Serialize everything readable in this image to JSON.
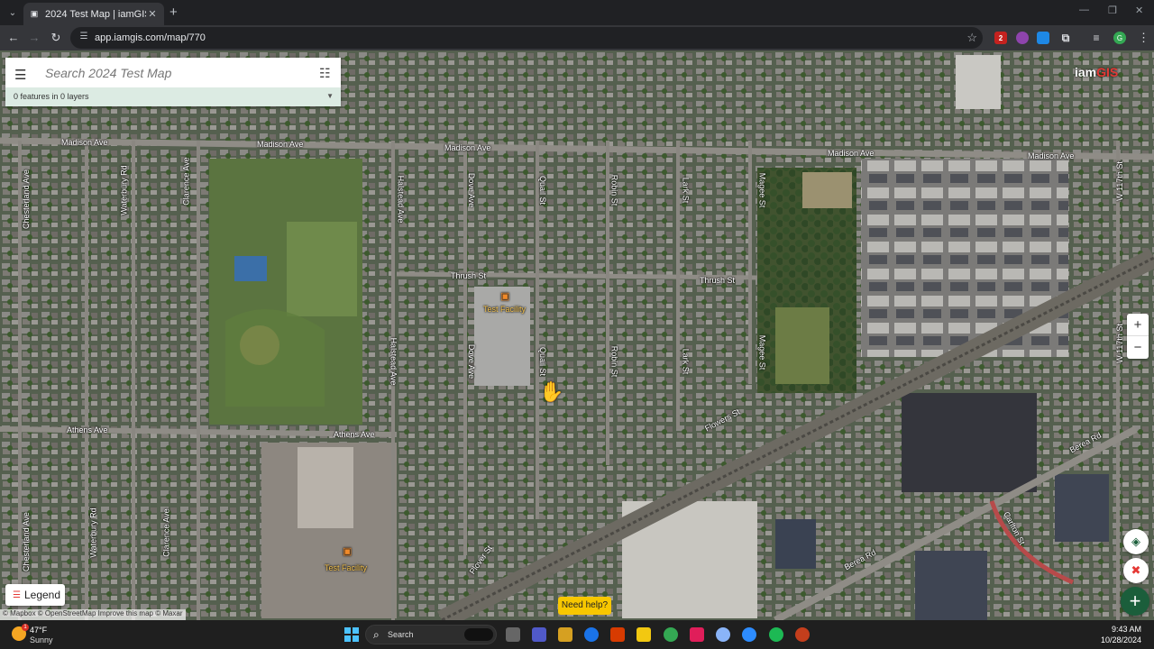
{
  "browser": {
    "tab_title": "2024 Test Map | iamGIS",
    "url": "app.iamgis.com/map/770",
    "ext_badges": [
      "2"
    ]
  },
  "map": {
    "search_placeholder": "Search 2024 Test Map",
    "features_summary": "0 features in 0 layers",
    "brand_main": "iam",
    "brand_accent": "GIS",
    "zoom_in": "+",
    "zoom_out": "−",
    "add_button": "+",
    "legend_label": "Legend",
    "attribution": "© Mapbox © OpenStreetMap  Improve this map © Maxar",
    "help_button": "Need help?",
    "road_labels": [
      {
        "text": "Madison Ave"
      },
      {
        "text": "Madison Ave"
      },
      {
        "text": "Madison Ave"
      },
      {
        "text": "Madison Ave"
      },
      {
        "text": "Madison Ave"
      },
      {
        "text": "Thrush St"
      },
      {
        "text": "Thrush St"
      },
      {
        "text": "Athens Ave"
      },
      {
        "text": "Athens Ave"
      },
      {
        "text": "Halstead Ave"
      },
      {
        "text": "Halstead Ave"
      },
      {
        "text": "Dove Ave"
      },
      {
        "text": "Dove Ave"
      },
      {
        "text": "Quail St"
      },
      {
        "text": "Quail St"
      },
      {
        "text": "Robin St"
      },
      {
        "text": "Robin St"
      },
      {
        "text": "Lark St"
      },
      {
        "text": "Lark St"
      },
      {
        "text": "Magee St"
      },
      {
        "text": "Magee St"
      },
      {
        "text": "Waterbury Rd"
      },
      {
        "text": "Waterbury Rd"
      },
      {
        "text": "Clarence Ave"
      },
      {
        "text": "Clarence Ave"
      },
      {
        "text": "Chesterland Ave"
      },
      {
        "text": "Chesterland Ave"
      },
      {
        "text": "Flowers St"
      },
      {
        "text": "Plover St"
      },
      {
        "text": "Berea Rd"
      },
      {
        "text": "Berea Rd"
      },
      {
        "text": "Carlton St"
      },
      {
        "text": "W 117th St"
      },
      {
        "text": "W 117th St"
      }
    ],
    "poi_labels": [
      {
        "text": "Test Facility"
      },
      {
        "text": "Test Facility"
      }
    ]
  },
  "taskbar": {
    "temperature": "47°F",
    "condition": "Sunny",
    "search_label": "Search",
    "time": "9:43 AM",
    "date": "10/28/2024",
    "weather_badge": "1"
  },
  "colors": {
    "brand_green": "#1b5e3b",
    "brand_red": "#e53935",
    "features_bar": "#dcebe3",
    "help_yellow": "#f7c700"
  }
}
